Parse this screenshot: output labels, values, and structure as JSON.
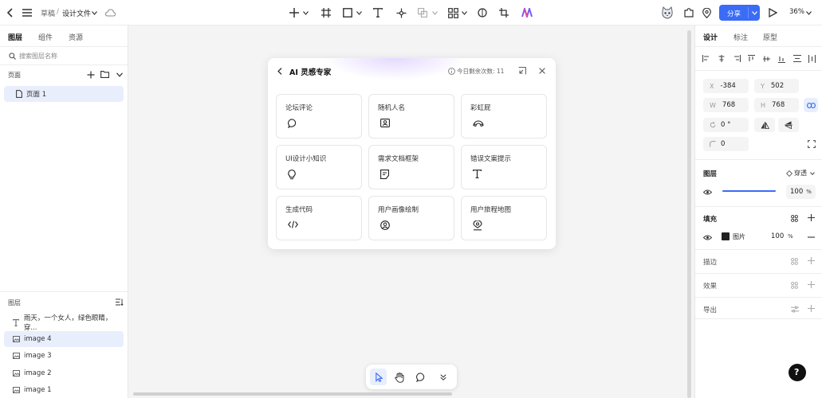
{
  "topbar": {
    "breadcrumb_parent": "草稿",
    "breadcrumb_sep": "/",
    "file_name": "设计文件",
    "share_label": "分享",
    "zoom": "36%"
  },
  "left_panel": {
    "tabs": [
      "图层",
      "组件",
      "资源"
    ],
    "search_placeholder": "搜索图层名称",
    "pages_title": "页面",
    "pages": [
      {
        "label": "页面 1"
      }
    ],
    "layers_title": "图层",
    "layers": [
      {
        "label": "雨天，一个女人，绿色眼睛，穿...",
        "icon": "text-icon"
      },
      {
        "label": "image 4",
        "icon": "image-icon"
      },
      {
        "label": "image 3",
        "icon": "image-icon"
      },
      {
        "label": "image 2",
        "icon": "image-icon"
      },
      {
        "label": "image 1",
        "icon": "image-icon"
      }
    ]
  },
  "dialog": {
    "title": "AI 灵感专家",
    "remaining_label": "今日剩余次数: 11",
    "cards": [
      {
        "label": "论坛评论",
        "icon": "chat-bubble-icon"
      },
      {
        "label": "随机人名",
        "icon": "id-card-icon"
      },
      {
        "label": "彩虹屁",
        "icon": "rainbow-icon"
      },
      {
        "label": "UI设计小知识",
        "icon": "lightbulb-icon"
      },
      {
        "label": "需求文档框架",
        "icon": "document-icon"
      },
      {
        "label": "错误文案提示",
        "icon": "text-t-icon"
      },
      {
        "label": "生成代码",
        "icon": "code-icon"
      },
      {
        "label": "用户画像绘制",
        "icon": "user-circle-icon"
      },
      {
        "label": "用户旅程地图",
        "icon": "map-pin-user-icon"
      }
    ]
  },
  "right_panel": {
    "tabs": [
      "设计",
      "标注",
      "原型"
    ],
    "x_label": "X",
    "x_value": "-384",
    "y_label": "Y",
    "y_value": "502",
    "w_label": "W",
    "w_value": "768",
    "h_label": "H",
    "h_value": "768",
    "rotation": "0 °",
    "radius": "0",
    "layer_section": "图层",
    "blend_mode": "穿透",
    "opacity": "100",
    "percent": "%",
    "opacity_fraction": 1.0,
    "fill_section": "填充",
    "fill_type": "图片",
    "fill_opacity": "100",
    "stroke_section": "描边",
    "effects_section": "效果",
    "export_section": "导出"
  },
  "help_label": "?",
  "colors": {
    "accent": "#3b6cf6",
    "selected_bg": "#e8eefc",
    "canvas_bg": "#f4f4f4"
  }
}
